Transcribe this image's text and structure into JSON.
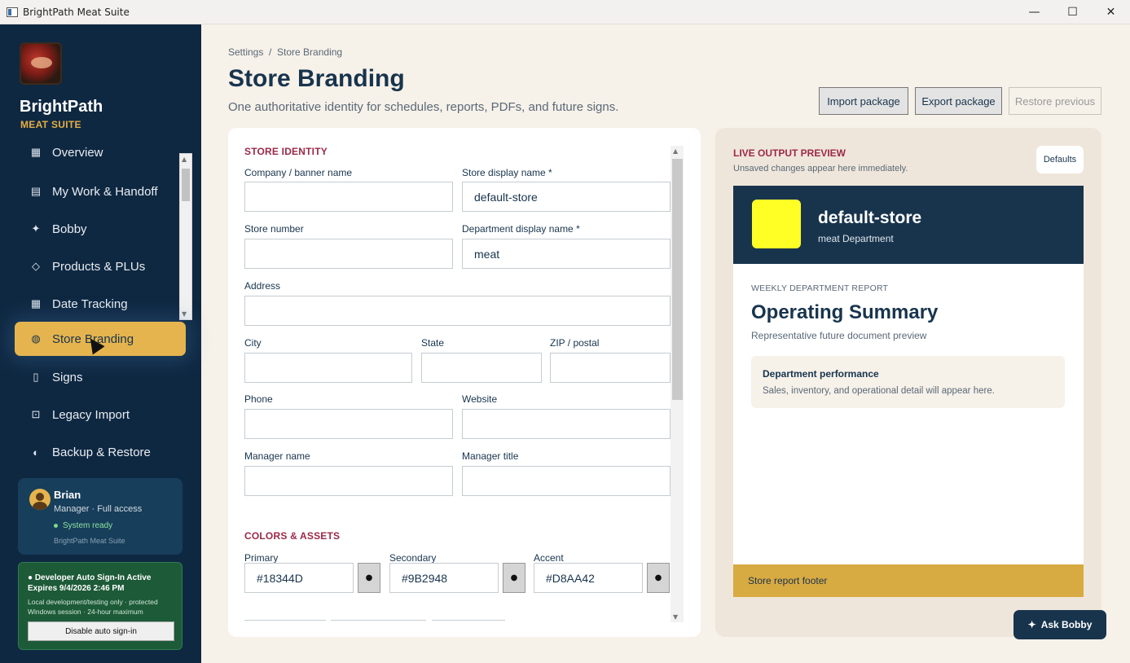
{
  "window": {
    "title": "BrightPath Meat Suite",
    "minimize": "—",
    "maximize": "☐",
    "close": "✕"
  },
  "sidebar": {
    "brand_name": "BrightPath",
    "brand_sub": "MEAT SUITE",
    "items": [
      {
        "label": "Overview",
        "icon": "dashboard-icon",
        "glyph": "▦"
      },
      {
        "label": "My Work & Handoff",
        "icon": "clipboard-icon",
        "glyph": "▤"
      },
      {
        "label": "Bobby",
        "icon": "sparkle-icon",
        "glyph": "✦"
      },
      {
        "label": "Products & PLUs",
        "icon": "tag-icon",
        "glyph": "◇"
      },
      {
        "label": "Date Tracking",
        "icon": "calendar-icon",
        "glyph": "▦"
      },
      {
        "label": "Store Branding",
        "icon": "palette-icon",
        "glyph": "◍"
      },
      {
        "label": "Signs",
        "icon": "sign-icon",
        "glyph": "▯"
      },
      {
        "label": "Legacy Import",
        "icon": "import-icon",
        "glyph": "⊡"
      },
      {
        "label": "Backup & Restore",
        "icon": "shield-icon",
        "glyph": "◐"
      }
    ],
    "active_item": "Store Branding",
    "user": {
      "name": "Brian",
      "role": "Manager · Full access",
      "status": "System ready",
      "app": "BrightPath Meat Suite"
    },
    "dev": {
      "title": "● Developer Auto Sign-In Active Expires 9/4/2026 2:46 PM",
      "desc": "Local development/testing only · protected Windows session · 24-hour maximum",
      "button": "Disable auto sign-in"
    }
  },
  "header": {
    "breadcrumb": "Settings  /  Store Branding",
    "title": "Store Branding",
    "subtitle": "One authoritative identity for schedules, reports, PDFs, and future signs.",
    "import": "Import package",
    "export": "Export package",
    "restore": "Restore previous"
  },
  "form": {
    "identity_title": "STORE IDENTITY",
    "company_label": "Company / banner name",
    "company_value": "",
    "store_name_label": "Store display name *",
    "store_name_value": "default-store",
    "store_number_label": "Store number",
    "store_number_value": "",
    "dept_label": "Department display name *",
    "dept_value": "meat",
    "address_label": "Address",
    "address_value": "",
    "city_label": "City",
    "state_label": "State",
    "zip_label": "ZIP / postal",
    "phone_label": "Phone",
    "website_label": "Website",
    "manager_name_label": "Manager name",
    "manager_title_label": "Manager title",
    "colors_title": "COLORS & ASSETS",
    "primary_label": "Primary",
    "primary_value": "#18344D",
    "secondary_label": "Secondary",
    "secondary_value": "#9B2948",
    "accent_label": "Accent",
    "accent_value": "#D8AA42",
    "picker_glyph": "●"
  },
  "preview": {
    "title": "LIVE OUTPUT PREVIEW",
    "subtitle": "Unsaved changes appear here immediately.",
    "defaults": "Defaults",
    "store_name": "default-store",
    "department": "meat Department",
    "kicker": "WEEKLY DEPARTMENT REPORT",
    "heading": "Operating Summary",
    "heading_sub": "Representative future document preview",
    "card_title": "Department performance",
    "card_desc": "Sales, inventory, and operational detail will appear here.",
    "footer": "Store report footer",
    "swatch_color": "#FFFF26"
  },
  "ask_bobby": "Ask Bobby",
  "colors": {
    "navy": "#18344D",
    "crimson": "#9B2948",
    "gold": "#D8AA42",
    "sidebar_bg": "#0F2842",
    "active_nav": "#E5B44E"
  }
}
